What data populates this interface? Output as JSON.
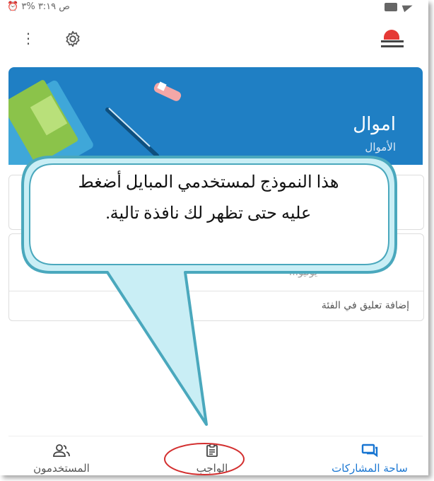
{
  "status_bar": {
    "time": "ص ٣:١٩",
    "battery": "%٣",
    "icons": [
      "alarm-icon",
      "wifi-icon",
      "signal-icon",
      "battery-icon",
      "folder-icon",
      "send-icon"
    ]
  },
  "toolbar": {
    "icons": [
      "more-vert-icon",
      "gear-icon",
      "menu-icon"
    ]
  },
  "banner": {
    "title": "اموال",
    "subtitle": "الأموال",
    "color": "#1f7fc4"
  },
  "card2": {
    "faint_text": "...يوليو",
    "comment_link": "إضافة تعليق في الفئة"
  },
  "callout": {
    "line1": "هذا النموذج لمستخدمي المبايل أضغط",
    "line2": "عليه حتى تظهر لك نافذة تالية.",
    "fill": "#c9eef5",
    "stroke": "#4aa8bd"
  },
  "bottom_nav": {
    "items": [
      {
        "label": "ساحة المشاركات",
        "icon": "forum-icon",
        "active": true
      },
      {
        "label": "الواجب",
        "icon": "assignment-icon",
        "active": false
      },
      {
        "label": "المستخدمون",
        "icon": "people-icon",
        "active": false
      }
    ],
    "active_color": "#1976d2",
    "highlight_ring_color": "#d32f2f"
  }
}
